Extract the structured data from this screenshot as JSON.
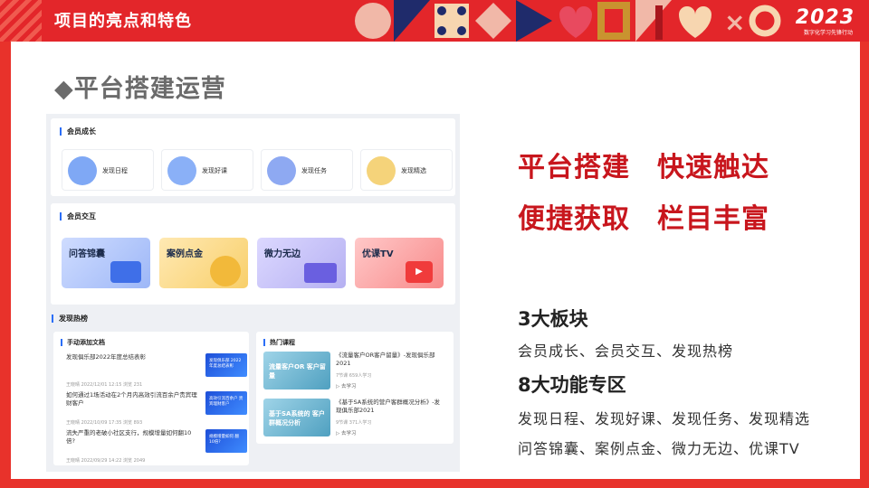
{
  "header": {
    "title": "项目的亮点和特色",
    "logo_year": "2023",
    "logo_sub": "数字化学习先锋行动"
  },
  "section_title": "◆平台搭建运营",
  "member_growth": {
    "title": "会员成长",
    "tiles": [
      {
        "label": "发现日程",
        "icon": "calendar-icon",
        "color": "#7fa8f5"
      },
      {
        "label": "发现好课",
        "icon": "book-icon",
        "color": "#8ab0f7"
      },
      {
        "label": "发现任务",
        "icon": "clipboard-icon",
        "color": "#8ea9f2"
      },
      {
        "label": "发现精选",
        "icon": "star-icon",
        "color": "#f5d37a"
      }
    ]
  },
  "member_interact": {
    "title": "会员交互",
    "cards": [
      {
        "label": "问答锦囊",
        "bg": "#b9cbfb"
      },
      {
        "label": "案例点金",
        "bg": "#fbdb8e"
      },
      {
        "label": "微力无边",
        "bg": "#c9c4f7"
      },
      {
        "label": "优课TV",
        "bg": "#fba6a6"
      }
    ]
  },
  "discover_hot": {
    "title": "发现热榜",
    "manual_docs": {
      "title": "手动添加文档",
      "items": [
        {
          "title": "发现俱乐部2022年度总结表彰",
          "meta": "王晓晴    2022/12/01 12:15    浏览 231",
          "thumb": "发现俱乐部 2022年度总结表彰"
        },
        {
          "title": "如何通过1场活动在2个月内高效引流百余户贵宾理财客户",
          "meta": "王晓晴    2022/10/09 17:35    浏览 893",
          "thumb": "高效引流百余户 贵宾理财客户"
        },
        {
          "title": "流失严重的老破小社区支行，规模增量如何翻10倍?",
          "meta": "王晓晴    2022/09/29 14:22    浏览 2049",
          "thumb": "规模增量如何 翻10倍?"
        }
      ]
    },
    "hot_courses": {
      "title": "热门课程",
      "items": [
        {
          "title": "《流量客户OR客户留量》-发现俱乐部2021",
          "meta": "7节课    659人学习",
          "go": "去学习",
          "img": "流量客户OR 客户留量"
        },
        {
          "title": "《基于SA系统的营户客群概况分析》-发现俱乐部2021",
          "meta": "9节课    371人学习",
          "go": "去学习",
          "img": "基于SA系统的 客户群概况分析"
        }
      ]
    }
  },
  "right": {
    "slogan_line1": [
      "平台搭建",
      "快速触达"
    ],
    "slogan_line2": [
      "便捷获取",
      "栏目丰富"
    ],
    "kpi1": "3大板块",
    "kpi1_desc": "会员成长、会员交互、发现热榜",
    "kpi2": "8大功能专区",
    "kpi2_desc1": "发现日程、发现好课、发现任务、发现精选",
    "kpi2_desc2": "问答锦囊、案例点金、微力无边、优课TV"
  }
}
